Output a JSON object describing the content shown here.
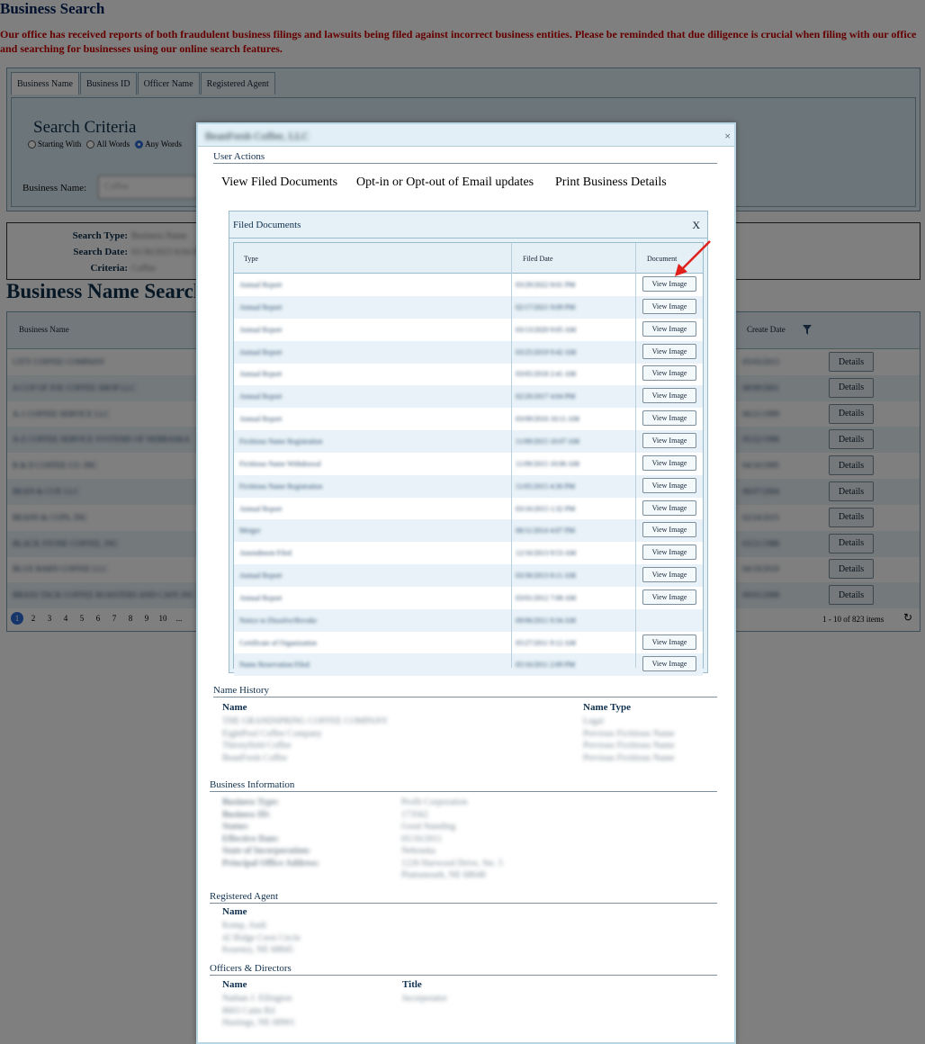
{
  "page": {
    "title": "Business Search",
    "warning": "Our office has received reports of both fraudulent business filings and lawsuits being filed against incorrect business entities. Please be reminded that due diligence is crucial when filing with our office and searching for businesses using our online search features."
  },
  "search": {
    "tabs": [
      "Business Name",
      "Business ID",
      "Officer Name",
      "Registered Agent"
    ],
    "criteria_title": "Search Criteria",
    "radio_options": [
      "Starting With",
      "All Words",
      "Any Words"
    ],
    "selected_radio": "Any Words",
    "business_name_label": "Business Name:",
    "business_name_value": "Coffee"
  },
  "search_info": {
    "type_label": "Search Type:",
    "type_value": "Business Name",
    "date_label": "Search Date:",
    "date_value": "01/30/2023 8:04 PM",
    "criteria_label": "Criteria:",
    "criteria_value": "Coffee"
  },
  "results": {
    "title": "Business Name Search Results",
    "col_name": "Business Name",
    "col_create_date": "Create Date",
    "details_label": "Details",
    "rows": [
      {
        "name": "CITY COFFEE COMPANY",
        "date": "05/03/2013"
      },
      {
        "name": "A CUP OF JOE COFFEE SHOP LLC",
        "date": "08/09/2001"
      },
      {
        "name": "A-1 COFFEE SERVICE LLC",
        "date": "06/21/1999"
      },
      {
        "name": "A-Z COFFEE SERVICE SYSTEMS OF NEBRASKA",
        "date": "05/22/1996"
      },
      {
        "name": "B & D COFFEE CO. INC",
        "date": "04/10/1995"
      },
      {
        "name": "BEAN & CUP, LLC",
        "date": "08/07/2004"
      },
      {
        "name": "BEANS & CUPS, INC",
        "date": "02/24/2015"
      },
      {
        "name": "BLACK STONE COFFEE, INC",
        "date": "03/21/1988"
      },
      {
        "name": "BLUE BARN COFFEE LLC",
        "date": "04/19/2019"
      },
      {
        "name": "BRASS TACK COFFEE ROASTERS AND CAFE INC",
        "date": "09/01/2008"
      }
    ],
    "pages": [
      "1",
      "2",
      "3",
      "4",
      "5",
      "6",
      "7",
      "8",
      "9",
      "10",
      "..."
    ],
    "count_text": "1 - 10 of 823 items"
  },
  "modal": {
    "title": "BeanFresh Coffee, LLC",
    "close": "×",
    "user_actions_heading": "User Actions",
    "actions": [
      "View Filed Documents",
      "Opt-in or Opt-out of Email updates",
      "Print Business Details"
    ],
    "filed_docs": {
      "title": "Filed Documents",
      "close": "X",
      "col_type": "Type",
      "col_date": "Filed Date",
      "col_doc": "Document",
      "button_label": "View Image",
      "rows": [
        {
          "type": "Annual Report",
          "date": "03/29/2022 8:01 PM",
          "has_image": true
        },
        {
          "type": "Annual Report",
          "date": "02/17/2021 9:09 PM",
          "has_image": true
        },
        {
          "type": "Annual Report",
          "date": "03/13/2020 9:05 AM",
          "has_image": true
        },
        {
          "type": "Annual Report",
          "date": "03/25/2019 9:42 AM",
          "has_image": true
        },
        {
          "type": "Annual Report",
          "date": "03/05/2018 2:41 AM",
          "has_image": true
        },
        {
          "type": "Annual Report",
          "date": "02/20/2017 4:04 PM",
          "has_image": true
        },
        {
          "type": "Annual Report",
          "date": "03/09/2016 10:11 AM",
          "has_image": true
        },
        {
          "type": "Fictitious Name Registration",
          "date": "11/09/2015 10:07 AM",
          "has_image": true
        },
        {
          "type": "Fictitious Name Withdrawal",
          "date": "11/09/2015 10:06 AM",
          "has_image": true
        },
        {
          "type": "Fictitious Name Registration",
          "date": "11/05/2015 4:30 PM",
          "has_image": true
        },
        {
          "type": "Annual Report",
          "date": "03/16/2015 1:32 PM",
          "has_image": true
        },
        {
          "type": "Merger",
          "date": "08/11/2014 4:07 PM",
          "has_image": true
        },
        {
          "type": "Amendment Filed",
          "date": "12/16/2013 9:53 AM",
          "has_image": true
        },
        {
          "type": "Annual Report",
          "date": "03/30/2013 8:11 AM",
          "has_image": true
        },
        {
          "type": "Annual Report",
          "date": "03/01/2012 7:08 AM",
          "has_image": true
        },
        {
          "type": "Notice to Dissolve/Revoke",
          "date": "09/06/2011 9:34 AM",
          "has_image": false
        },
        {
          "type": "Certificate of Organization",
          "date": "05/27/2011 9:12 AM",
          "has_image": true
        },
        {
          "type": "Name Reservation Filed",
          "date": "05/16/2011 2:09 PM",
          "has_image": true
        }
      ]
    },
    "name_history": {
      "heading": "Name History",
      "col_name": "Name",
      "col_type": "Name Type",
      "names": [
        "THE GRANDSPRING COFFEE COMPANY",
        "EightPool Coffee Company",
        "Thirstyfield Coffee",
        "BeanFresh Coffee"
      ],
      "types": [
        "Legal",
        "Previous Fictitious Name",
        "Previous Fictitious Name",
        "Previous Fictitious Name"
      ]
    },
    "business_info": {
      "heading": "Business Information",
      "labels": [
        "Business Type:",
        "Business ID:",
        "Status:",
        "Effective Date:",
        "State of Incorporation:",
        "Principal Office Address:"
      ],
      "values": [
        "Profit Corporation",
        "173562",
        "Good Standing",
        "05/16/2011",
        "Nebraska",
        "1226 Harwood Drive, Ste. 5",
        "Plattsmouth, NE 68048"
      ]
    },
    "registered_agent": {
      "heading": "Registered Agent",
      "col_name": "Name",
      "lines": [
        "Kemp, Andi",
        "42 Ridge Crest Circle",
        "Kearney, NE 68845"
      ]
    },
    "officers": {
      "heading": "Officers & Directors",
      "col_name": "Name",
      "col_title": "Title",
      "lines": [
        "Nathan J. Ellington",
        "8603 Calm Rd",
        "Hastings, NE 68901"
      ],
      "title_value": "Incorporator"
    }
  }
}
